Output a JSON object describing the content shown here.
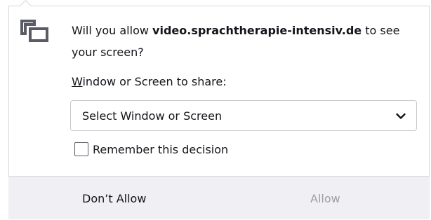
{
  "prompt": {
    "message_prefix": "Will you allow ",
    "site": "video.sprachtherapie-intensiv.de",
    "message_suffix": " to see your screen?"
  },
  "share": {
    "label": "Window or Screen to share:",
    "selected_value": "Select Window or Screen"
  },
  "remember": {
    "label": "Remember this decision",
    "checked": false
  },
  "buttons": {
    "deny_label": "Don’t Allow",
    "allow_label": "Allow",
    "allow_enabled": false
  },
  "icons": {
    "prompt": "screen-share-icon",
    "dropdown": "chevron-down-icon"
  },
  "colors": {
    "footer_bg": "#f0f0f4",
    "disabled_text": "#9e9ea6",
    "text": "#15141a"
  }
}
